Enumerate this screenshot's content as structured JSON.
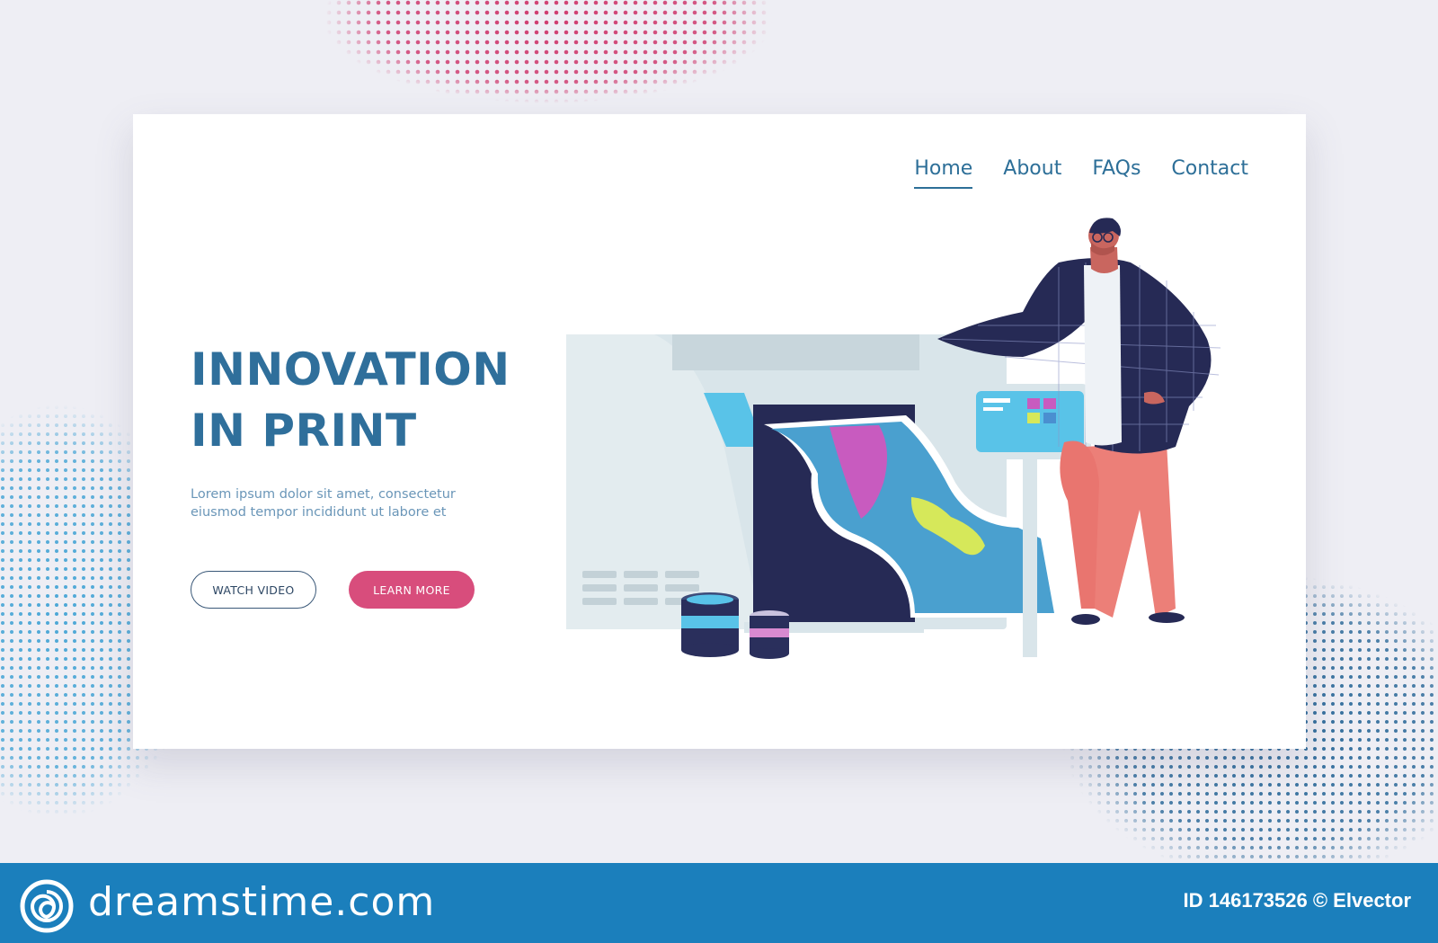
{
  "nav": {
    "items": [
      {
        "label": "Home",
        "active": true
      },
      {
        "label": "About",
        "active": false
      },
      {
        "label": "FAQs",
        "active": false
      },
      {
        "label": "Contact",
        "active": false
      }
    ]
  },
  "hero": {
    "title_line1": "INNOVATION",
    "title_line2": "IN PRINT",
    "description": "Lorem ipsum dolor sit amet, consectetur eiusmod tempor incididunt ut labore et",
    "watch_video_label": "WATCH VIDEO",
    "learn_more_label": "LEARN MORE"
  },
  "footer": {
    "brand": "dreamstime.com",
    "image_credit": "ID 146173526 © Elvector"
  },
  "colors": {
    "accent": "#2f6f9b",
    "button_pink": "#d84d7c",
    "footer_blue": "#1b7fbc",
    "printer_gray": "#d9e4e8",
    "paper_blue": "#4aa0cf",
    "ink_magenta": "#c85bbf",
    "ink_yellow": "#d6e85a"
  },
  "icons": {
    "footer_logo": "dreamstime-spiral-logo"
  }
}
